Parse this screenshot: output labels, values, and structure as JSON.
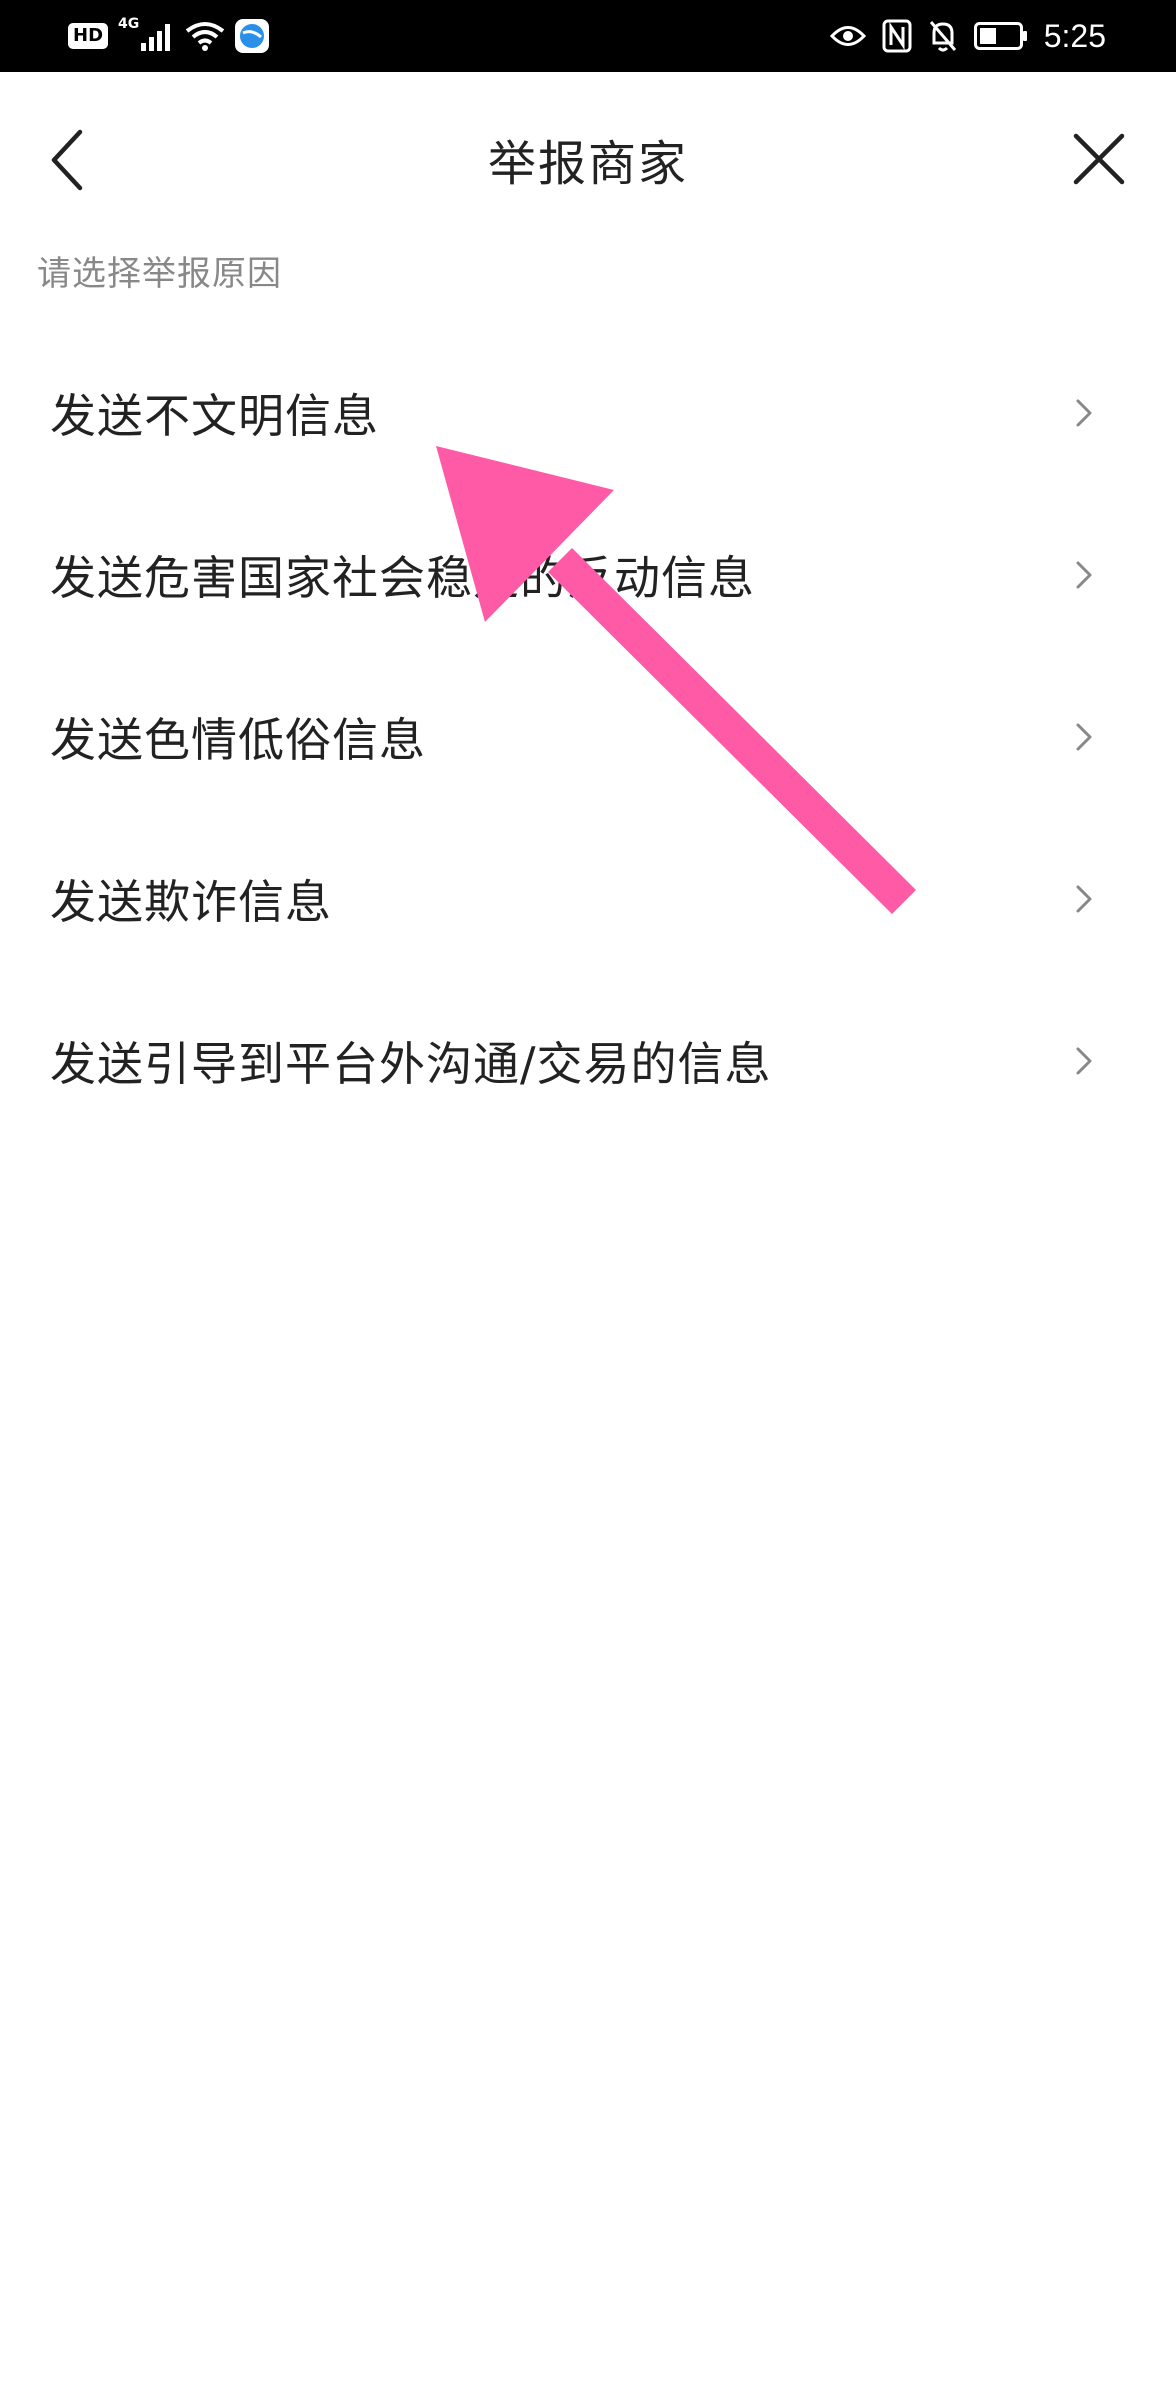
{
  "status_bar": {
    "hd_label": "HD",
    "network_label": "4G",
    "time": "5:25",
    "icons": [
      "hd-icon",
      "cellular-signal-icon",
      "wifi-icon",
      "browser-app-icon",
      "eye-icon",
      "nfc-icon",
      "bell-off-icon",
      "battery-icon"
    ]
  },
  "nav": {
    "title": "举报商家",
    "back_icon": "chevron-left-icon",
    "close_icon": "close-icon"
  },
  "hint": "请选择举报原因",
  "reasons": [
    {
      "label": "发送不文明信息"
    },
    {
      "label": "发送危害国家社会稳定的反动信息"
    },
    {
      "label": "发送色情低俗信息"
    },
    {
      "label": "发送欺诈信息"
    },
    {
      "label": "发送引导到平台外沟通/交易的信息"
    }
  ],
  "annotation": {
    "arrow_color": "#ff5aa5",
    "arrow_icon": "pointer-arrow-icon"
  }
}
